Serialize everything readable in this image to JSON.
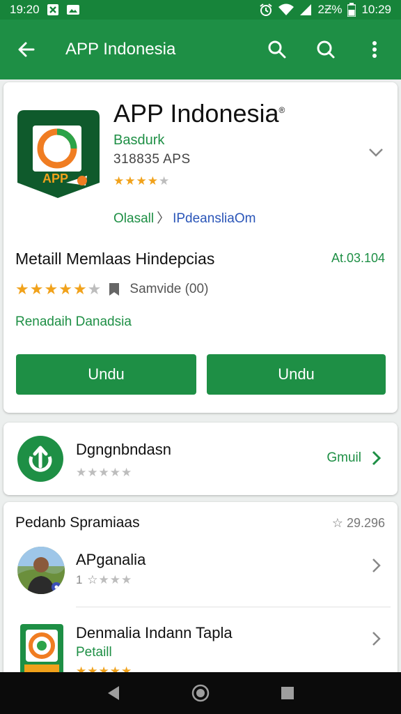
{
  "status_bar": {
    "time_left": "19:20",
    "battery_text": "2Ƶ%",
    "time_right": "10:29"
  },
  "app_bar": {
    "title": "APP Indonesia",
    "icons": [
      "back-arrow-icon",
      "search-icon",
      "search-icon",
      "more-vert-icon"
    ],
    "color": "#1e8f45"
  },
  "app": {
    "name": "APP Indonesia",
    "name_mark": "®",
    "icon_label": "APP",
    "developer": "Basdurk",
    "category": "318835 APS",
    "rating_stars": 4,
    "link_primary": "Olasall",
    "link_sep": "〉",
    "link_secondary": "IPdeansliaOm"
  },
  "meta": {
    "title": "Metaill Memlaas Hindepcias",
    "version": "At.03.104",
    "rating_stars": 5,
    "rating_text": "Samvide (00)",
    "green_link": "Renadaih Danadsia"
  },
  "buttons": {
    "left_label": "Undu",
    "right_label": "Undu"
  },
  "update": {
    "title": "Dgngnbndasn",
    "stars": 0,
    "link": "Gmuil"
  },
  "related": {
    "section_title": "Pedanb Spramiaas",
    "count": "29.296",
    "items": [
      {
        "title": "APganalia",
        "rating_prefix": "1",
        "stars": 3
      },
      {
        "title": "Denmalia Indann Tapla",
        "subtitle": "Petaill",
        "stars": 5
      }
    ]
  },
  "colors": {
    "accent": "#1e8f45",
    "status_bar": "#17843a",
    "star": "#f1a21b",
    "link_blue": "#2a55b8"
  }
}
